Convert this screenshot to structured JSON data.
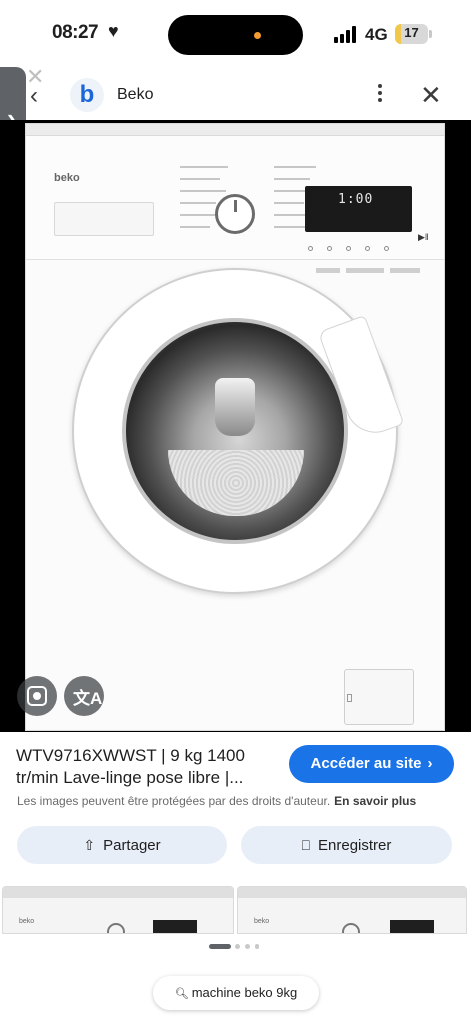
{
  "status_bar": {
    "time": "08:27",
    "network": "4G",
    "battery": "17",
    "battery_level": 0.17
  },
  "header": {
    "site_logo_letter": "b",
    "site_name": "Beko"
  },
  "image": {
    "brand": "beko",
    "display_text": "1:00"
  },
  "info": {
    "title": "WTV9716XWWST | 9 kg 1400 tr/min Lave-linge pose libre |...",
    "visit_label": "Accéder au site",
    "copyright_text": "Les images peuvent être protégées par des droits d'auteur.",
    "learn_more": "En savoir plus"
  },
  "actions": {
    "share_label": "Partager",
    "save_label": "Enregistrer"
  },
  "related": {
    "thumb1_logo": "beko",
    "thumb2_logo": "beko"
  },
  "search_chip": {
    "query": "machine beko 9kg"
  },
  "colors": {
    "accent": "#1b73e8",
    "chip_bg": "#e8eef8",
    "battery": "#f2c84b"
  },
  "icons": [
    "heart-icon",
    "signal-icon",
    "battery-icon",
    "back-icon",
    "more-icon",
    "close-icon",
    "lens-icon",
    "translate-icon",
    "share-icon",
    "bookmark-icon",
    "search-icon",
    "chevron-right-icon"
  ]
}
